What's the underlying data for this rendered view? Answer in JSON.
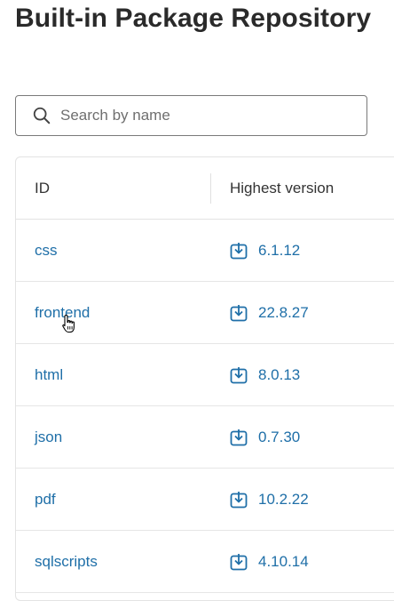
{
  "page": {
    "title": "Built-in Package Repository"
  },
  "search": {
    "placeholder": "Search by name",
    "value": ""
  },
  "table": {
    "headers": {
      "id": "ID",
      "version": "Highest version"
    },
    "rows": [
      {
        "id": "css",
        "version": "6.1.12"
      },
      {
        "id": "frontend",
        "version": "22.8.27"
      },
      {
        "id": "html",
        "version": "8.0.13"
      },
      {
        "id": "json",
        "version": "0.7.30"
      },
      {
        "id": "pdf",
        "version": "10.2.22"
      },
      {
        "id": "sqlscripts",
        "version": "4.10.14"
      }
    ]
  },
  "icons": {
    "search": "search-icon",
    "download": "download-icon",
    "cursor": "hand-pointer-cursor"
  },
  "colors": {
    "link": "#1f6fa8",
    "title": "#2a2a2a",
    "border": "#e3e3e3"
  }
}
